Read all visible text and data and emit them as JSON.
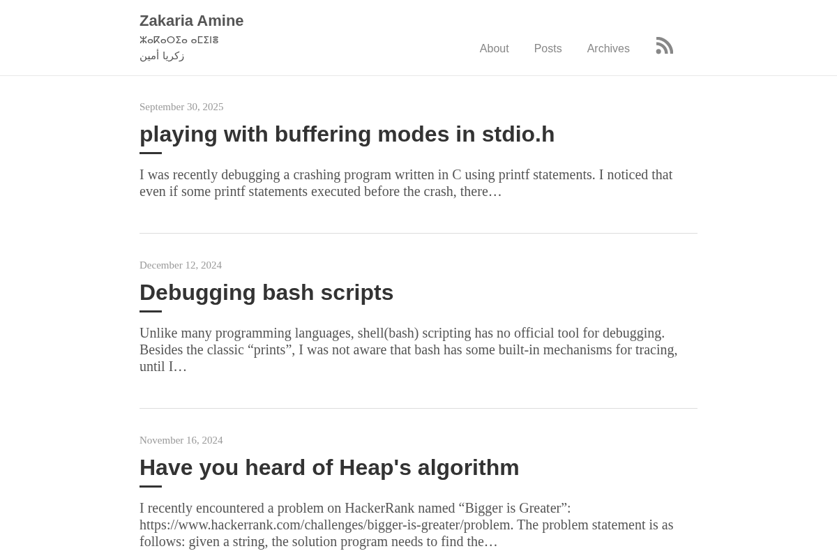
{
  "site": {
    "title": "Zakaria Amine",
    "subtitle_tifinagh": "ⵣⴰⴽⴰⵔⵉⴰ ⴰⵎⵉⵏⴻ",
    "subtitle_arabic": "زكريا أمين"
  },
  "nav": {
    "links": [
      "About",
      "Posts",
      "Archives"
    ]
  },
  "posts": [
    {
      "date": "September 30, 2025",
      "title": "playing with buffering modes in stdio.h",
      "excerpt": "I was recently debugging a crashing program written in C using printf statements. I noticed that even if some printf statements executed before the crash, there…"
    },
    {
      "date": "December 12, 2024",
      "title": "Debugging bash scripts",
      "excerpt": "Unlike many programming languages, shell(bash) scripting has no official tool for debugging. Besides the classic “prints”, I was not aware that bash has some built-in mechanisms for tracing, until I…"
    },
    {
      "date": "November 16, 2024",
      "title": "Have you heard of Heap's algorithm",
      "excerpt": "I recently encountered a problem on HackerRank named “Bigger is Greater”: https://www.hackerrank.com/challenges/bigger-is-greater/problem. The problem statement is as follows: given a string, the solution program needs to find the…"
    }
  ]
}
